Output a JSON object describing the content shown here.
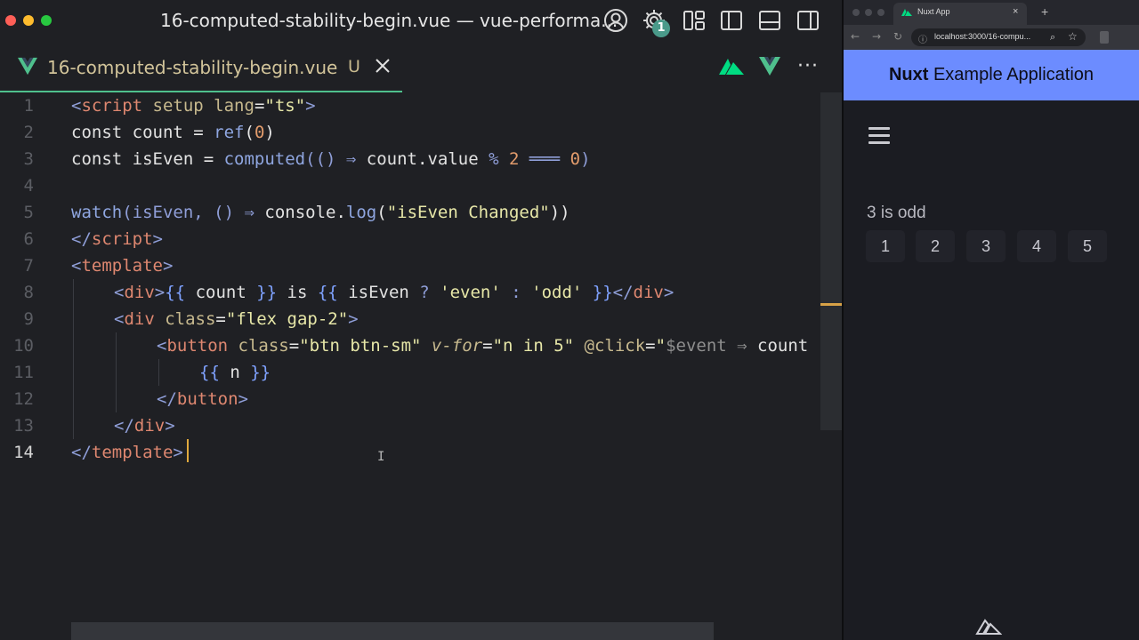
{
  "editor": {
    "window_title": "16-computed-stability-begin.vue — vue-performa...",
    "settings_badge": "1",
    "tab": {
      "name": "16-computed-stability-begin.vue",
      "status": "U"
    },
    "more_label": "···",
    "lines": [
      {
        "n": "1"
      },
      {
        "n": "2"
      },
      {
        "n": "3"
      },
      {
        "n": "4"
      },
      {
        "n": "5"
      },
      {
        "n": "6"
      },
      {
        "n": "7"
      },
      {
        "n": "8"
      },
      {
        "n": "9"
      },
      {
        "n": "10"
      },
      {
        "n": "11"
      },
      {
        "n": "12"
      },
      {
        "n": "13"
      },
      {
        "n": "14"
      }
    ],
    "code": {
      "l1": [
        "<",
        "script",
        " setup",
        " lang",
        "=",
        "\"ts\"",
        ">"
      ],
      "l2": [
        "const",
        " count",
        " = ",
        "ref",
        "(",
        "0",
        ")"
      ],
      "l3": [
        "const",
        " isEven",
        " = ",
        "computed",
        "(() ",
        "⇒",
        " count",
        ".",
        "value",
        " % ",
        "2",
        " ═══ ",
        "0",
        ")"
      ],
      "l5": [
        "watch",
        "(isEven, () ",
        "⇒",
        " console",
        ".",
        "log",
        "(",
        "\"isEven Changed\"",
        "))"
      ],
      "l6": [
        "</",
        "script",
        ">"
      ],
      "l7": [
        "<",
        "template",
        ">"
      ],
      "l8": [
        "<",
        "div",
        ">",
        "{{",
        " count ",
        "}}",
        " is ",
        "{{",
        " isEven ",
        "?",
        " 'even' ",
        ":",
        " 'odd' ",
        "}}",
        "</",
        "div",
        ">"
      ],
      "l9": [
        "<",
        "div",
        " class",
        "=",
        "\"flex gap-2\"",
        ">"
      ],
      "l10": [
        "<",
        "button",
        " class",
        "=",
        "\"btn btn-sm\"",
        " v-for",
        "=",
        "\"n in 5\"",
        " @click",
        "=",
        "\"",
        "$event",
        " ⇒ ",
        "count"
      ],
      "l11": [
        "{{",
        " n ",
        "}}"
      ],
      "l12": [
        "</",
        "button",
        ">"
      ],
      "l13": [
        "</",
        "div",
        ">"
      ],
      "l14": [
        "</",
        "template",
        ">"
      ]
    },
    "ibeam": "I"
  },
  "browser": {
    "tab_title": "Nuxt App",
    "tab_close": "×",
    "new_tab": "+",
    "url": "localhost:3000/16-compu...",
    "nav": {
      "back": "←",
      "forward": "→",
      "reload": "↻"
    },
    "page": {
      "header_brand": "Nuxt",
      "header_rest": " Example Application",
      "status_text": "3 is odd",
      "buttons": [
        "1",
        "2",
        "3",
        "4",
        "5"
      ]
    }
  },
  "colors": {
    "nuxt_header_bg": "#6c8cff",
    "vue_green": "#4fc08d",
    "cursor": "#e0a93d"
  }
}
